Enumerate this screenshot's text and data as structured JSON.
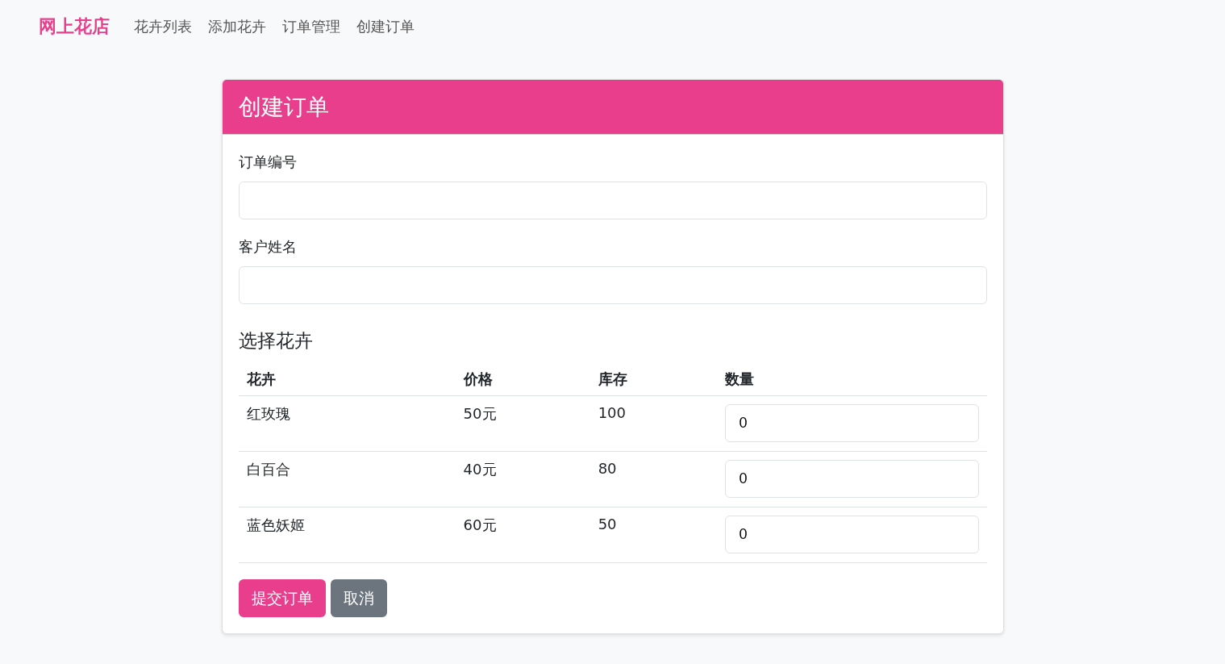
{
  "brand": "网上花店",
  "nav": [
    {
      "label": "花卉列表"
    },
    {
      "label": "添加花卉"
    },
    {
      "label": "订单管理"
    },
    {
      "label": "创建订单"
    }
  ],
  "card": {
    "title": "创建订单",
    "fields": [
      {
        "label": "订单编号"
      },
      {
        "label": "客户姓名"
      }
    ],
    "section_title": "选择花卉",
    "table": {
      "columns": [
        "花卉",
        "价格",
        "库存",
        "数量"
      ],
      "rows": [
        {
          "flower": "红玫瑰",
          "price": "50元",
          "stock": "100",
          "quantity": "0"
        },
        {
          "flower": "白百合",
          "price": "40元",
          "stock": "80",
          "quantity": "0"
        },
        {
          "flower": "蓝色妖姬",
          "price": "60元",
          "stock": "50",
          "quantity": "0"
        }
      ]
    },
    "buttons": [
      {
        "label": "提交订单",
        "kind": "primary"
      },
      {
        "label": "取消",
        "kind": "secondary"
      }
    ]
  }
}
